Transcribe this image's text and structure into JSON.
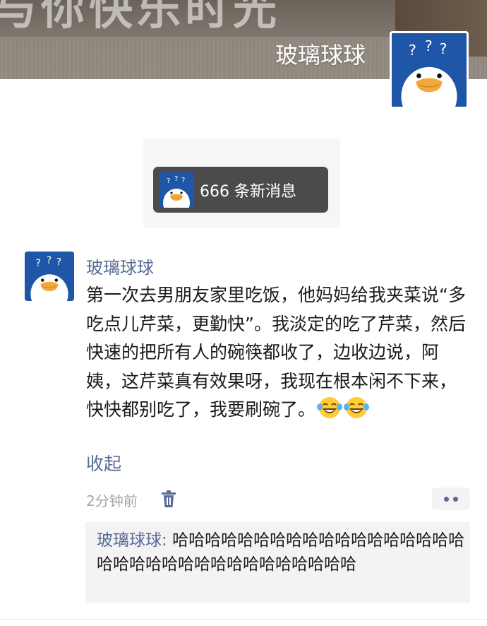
{
  "cover": {
    "art_text": "与你快乐时光",
    "owner_name": "玻璃球球"
  },
  "notice": {
    "text": "666 条新消息"
  },
  "post": {
    "author": "玻璃球球",
    "body": "第一次去男朋友家里吃饭，他妈妈给我夹菜说“多吃点儿芹菜，更勤快”。我淡定的吃了芹菜，然后快速的把所有人的碗筷都收了，边收边说，阿姨，这芹菜真有效果呀，我现在根本闲不下来，快快都别吃了，我要刷碗了。",
    "emoji": [
      "tears-of-joy-emoji",
      "tears-of-joy-emoji"
    ],
    "collapse_label": "收起",
    "time": "2分钟前",
    "delete_icon": "trash-icon",
    "more_icon": "more-dots-icon"
  },
  "comments": [
    {
      "author": "玻璃球球",
      "separator": ": ",
      "text": "哈哈哈哈哈哈哈哈哈哈哈哈哈哈哈哈哈哈哈哈哈哈哈哈哈哈哈哈哈哈哈哈哈哈"
    }
  ],
  "colors": {
    "link": "#576b95",
    "avatar_bg": "#1f56a8",
    "notice_bg": "#4b4b4b",
    "timestamp": "#a6a6a6"
  }
}
